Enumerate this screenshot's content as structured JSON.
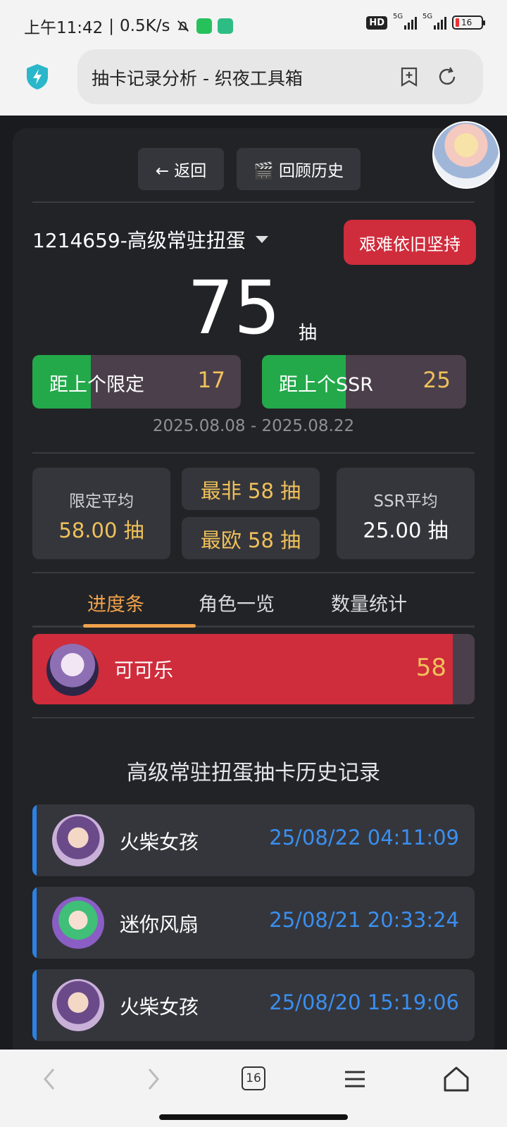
{
  "status_bar": {
    "time": "上午11:42",
    "speed": "0.5K/s",
    "hd_label": "HD",
    "net1": "5G",
    "net2": "5G",
    "battery": "16"
  },
  "browser": {
    "title": "抽卡记录分析 - 织夜工具箱"
  },
  "top_buttons": {
    "back": "← 返回",
    "review": "🎬 回顾历史"
  },
  "pool": {
    "title": "1214659-高级常驻扭蛋",
    "badge": "艰难依旧坚持",
    "total": "75",
    "unit": "抽",
    "since_limited_label": "距上个限定",
    "since_limited_value": "17",
    "since_limited_fill": 0.28,
    "since_ssr_label": "距上个SSR",
    "since_ssr_value": "25",
    "since_ssr_fill": 0.41,
    "date_range": "2025.08.08 - 2025.08.22"
  },
  "stats": {
    "limited_avg_label": "限定平均",
    "limited_avg_value": "58.00 抽",
    "worst": "最非 58 抽",
    "best": "最欧 58 抽",
    "ssr_avg_label": "SSR平均",
    "ssr_avg_value": "25.00 抽"
  },
  "tabs": [
    "进度条",
    "角色一览",
    "数量统计"
  ],
  "progress": {
    "name": "可可乐",
    "value": "58",
    "fill": 0.95
  },
  "history": {
    "title": "高级常驻扭蛋抽卡历史记录",
    "rows": [
      {
        "name": "火柴女孩",
        "time": "25/08/22 04:11:09"
      },
      {
        "name": "迷你风扇",
        "time": "25/08/21 20:33:24"
      },
      {
        "name": "火柴女孩",
        "time": "25/08/20 15:19:06"
      }
    ]
  },
  "nav": {
    "tab_count": "16"
  },
  "colors": {
    "accent_orange": "#f0a24a",
    "green": "#23a94a",
    "red": "#cf2c3c",
    "blue_time": "#3a8ff0",
    "gold": "#f0c15a"
  }
}
